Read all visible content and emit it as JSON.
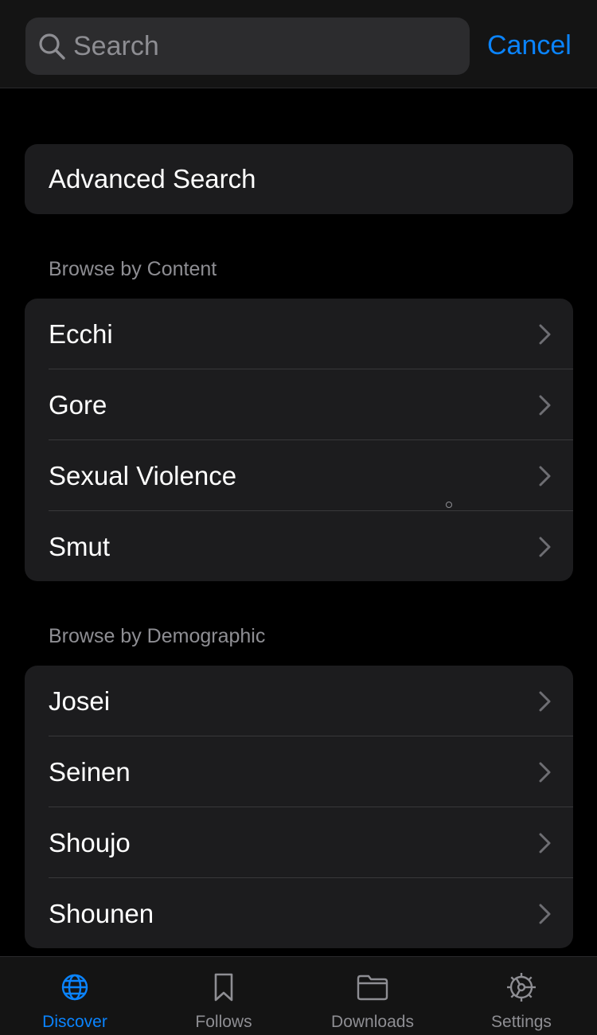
{
  "search": {
    "placeholder": "Search",
    "cancel_label": "Cancel"
  },
  "advanced_search": {
    "label": "Advanced Search"
  },
  "sections": [
    {
      "title": "Browse by Content",
      "items": [
        "Ecchi",
        "Gore",
        "Sexual Violence",
        "Smut"
      ]
    },
    {
      "title": "Browse by Demographic",
      "items": [
        "Josei",
        "Seinen",
        "Shoujo",
        "Shounen"
      ]
    }
  ],
  "tabbar": {
    "tabs": [
      {
        "label": "Discover",
        "icon": "globe-icon",
        "active": true
      },
      {
        "label": "Follows",
        "icon": "bookmark-icon",
        "active": false
      },
      {
        "label": "Downloads",
        "icon": "folder-icon",
        "active": false
      },
      {
        "label": "Settings",
        "icon": "gear-icon",
        "active": false
      }
    ]
  },
  "colors": {
    "accent": "#0a84ff",
    "background": "#000000",
    "card": "#1c1c1e",
    "secondary_text": "#8e8e93"
  }
}
